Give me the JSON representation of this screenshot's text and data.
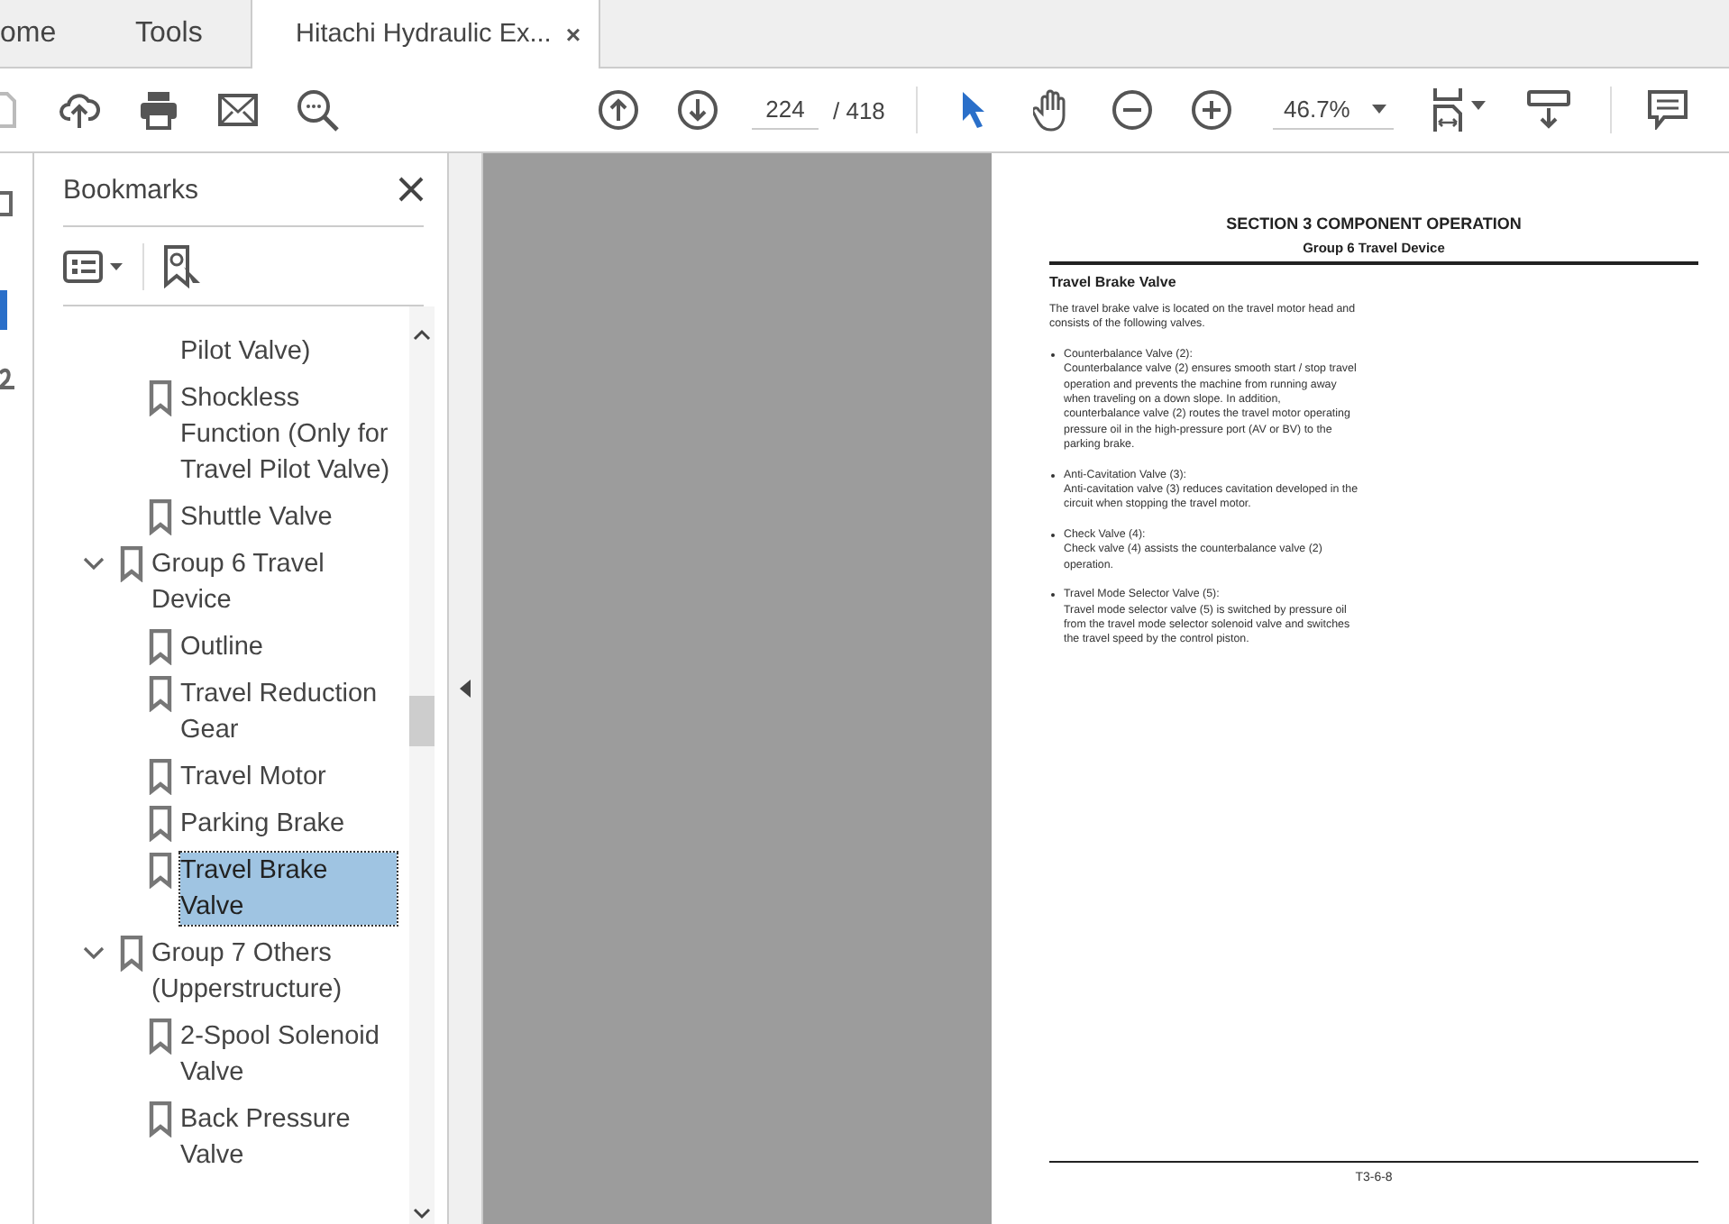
{
  "tabs": [
    {
      "label": "ome",
      "selected": false
    },
    {
      "label": "Tools",
      "selected": false
    },
    {
      "label": "Hitachi Hydraulic Ex...",
      "selected": true,
      "close": "×"
    }
  ],
  "toolbar": {
    "page_number": "224",
    "page_total": "/ 418",
    "zoom": "46.7%"
  },
  "bookmarks": {
    "title": "Bookmarks",
    "items": [
      {
        "label": "Pilot Valve)",
        "kind": "continued",
        "selected": false
      },
      {
        "label": "Shockless Function (Only for Travel Pilot Valve)",
        "kind": "bookmark",
        "selected": false
      },
      {
        "label": "Shuttle Valve",
        "kind": "bookmark",
        "selected": false
      },
      {
        "label": "Group 6 Travel Device",
        "kind": "group",
        "expanded": true,
        "selected": false,
        "children": [
          {
            "label": "Outline",
            "selected": false
          },
          {
            "label": "Travel Reduction Gear",
            "selected": false
          },
          {
            "label": "Travel Motor",
            "selected": false
          },
          {
            "label": "Parking Brake",
            "selected": false
          },
          {
            "label": "Travel Brake Valve",
            "selected": true
          }
        ]
      },
      {
        "label": "Group 7 Others (Upperstructure)",
        "kind": "group",
        "expanded": true,
        "selected": false,
        "children": [
          {
            "label": "2-Spool Solenoid Valve",
            "selected": false
          },
          {
            "label": "Back Pressure Valve",
            "selected": false
          }
        ]
      }
    ]
  },
  "document": {
    "section": "SECTION 3 COMPONENT OPERATION",
    "group": "Group 6 Travel Device",
    "heading": "Travel Brake Valve",
    "intro": "The travel brake valve is located on the travel motor head and consists of the following valves.",
    "bullets": [
      {
        "title": "Counterbalance Valve (2):",
        "text": "Counterbalance valve (2) ensures smooth start / stop travel operation and prevents the machine from running away when traveling on a down slope. In addition, counterbalance valve (2) routes the travel motor operating pressure oil in the high-pressure port (AV or BV) to the parking brake."
      },
      {
        "title": "Anti-Cavitation Valve (3):",
        "text": "Anti-cavitation valve (3) reduces cavitation developed in the circuit when stopping the travel motor."
      },
      {
        "title": "Check Valve (4):",
        "text": "Check valve (4) assists the counterbalance valve (2) operation."
      },
      {
        "title": "Travel Mode Selector Valve (5):",
        "text": "Travel mode selector valve (5) is switched by pressure oil from the travel mode selector solenoid valve and switches the travel speed by the control piston."
      }
    ],
    "page_label": "T3-6-8"
  }
}
